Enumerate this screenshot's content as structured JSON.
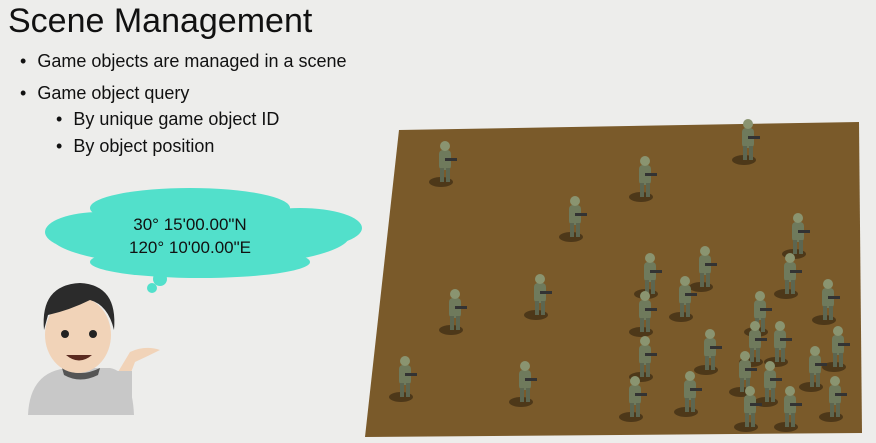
{
  "slide": {
    "title": "Scene Management",
    "bullets": [
      {
        "text": "Game objects are managed in a scene"
      },
      {
        "text": "Game object query",
        "sub": [
          "By unique game object ID",
          "By object position"
        ]
      }
    ],
    "thought_bubble": {
      "line1": "30°  15'00.00\"N",
      "line2": "120°  10'00.00\"E",
      "color": "#52e0cb"
    },
    "scene_ground_color": "#7a5a2a"
  }
}
